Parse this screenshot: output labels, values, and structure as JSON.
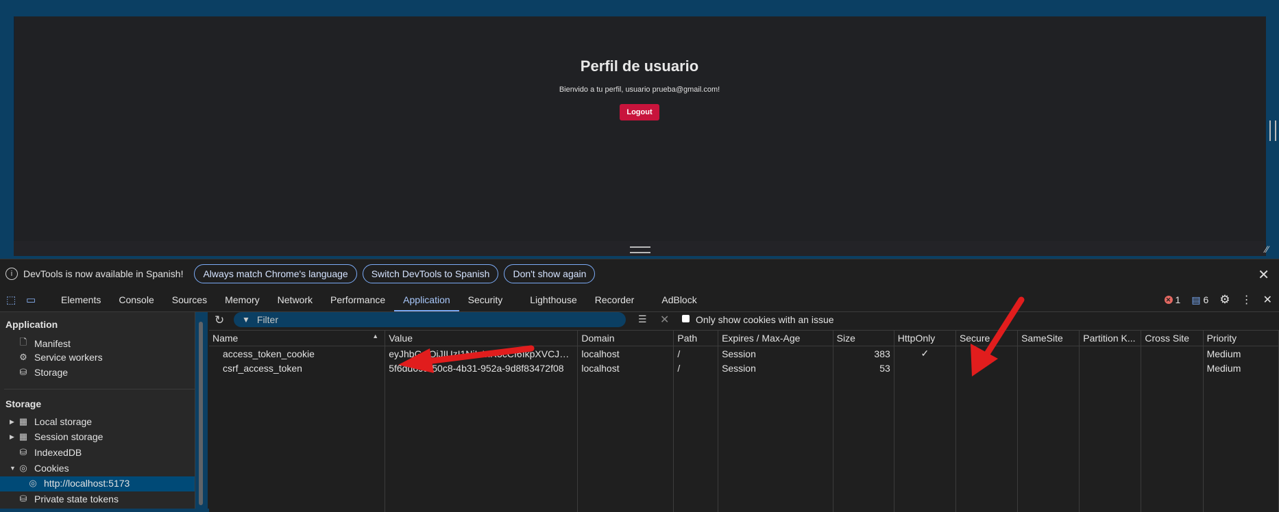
{
  "page": {
    "title": "Perfil de usuario",
    "welcome": "Bienvido a tu perfil, usuario prueba@gmail.com!",
    "logout_label": "Logout"
  },
  "infobar": {
    "message": "DevTools is now available in Spanish!",
    "btn_match": "Always match Chrome's language",
    "btn_switch": "Switch DevTools to Spanish",
    "btn_dismiss": "Don't show again"
  },
  "tabs": [
    {
      "label": "Elements"
    },
    {
      "label": "Console"
    },
    {
      "label": "Sources"
    },
    {
      "label": "Memory"
    },
    {
      "label": "Network"
    },
    {
      "label": "Performance"
    },
    {
      "label": "Application"
    },
    {
      "label": "Security"
    },
    {
      "label": "Lighthouse"
    },
    {
      "label": "Recorder"
    },
    {
      "label": "AdBlock"
    }
  ],
  "status": {
    "errors": "1",
    "messages": "6"
  },
  "sidebar": {
    "application_header": "Application",
    "app_items": [
      "Manifest",
      "Service workers",
      "Storage"
    ],
    "storage_header": "Storage",
    "storage_items": [
      "Local storage",
      "Session storage",
      "IndexedDB",
      "Cookies",
      "http://localhost:5173",
      "Private state tokens"
    ]
  },
  "filter": {
    "placeholder": "Filter",
    "only_issues_label": "Only show cookies with an issue"
  },
  "table": {
    "columns": [
      "Name",
      "Value",
      "Domain",
      "Path",
      "Expires / Max-Age",
      "Size",
      "HttpOnly",
      "Secure",
      "SameSite",
      "Partition K...",
      "Cross Site",
      "Priority"
    ],
    "rows": [
      [
        "access_token_cookie",
        "eyJhbGciOiJIUzI1NiIsInR5cCI6IkpXVCJ9.eyJmcmVz...",
        "localhost",
        "/",
        "Session",
        "383",
        "✓",
        "",
        "",
        "",
        "",
        "Medium"
      ],
      [
        "csrf_access_token",
        "5f6dd69a-50c8-4b31-952a-9d8f83472f08",
        "localhost",
        "/",
        "Session",
        "53",
        "",
        "",
        "",
        "",
        "",
        "Medium"
      ]
    ]
  },
  "colors": {
    "accent": "#7cacf8",
    "logout": "#c8143c",
    "arrow": "#e11d1d",
    "selected": "#004a77"
  }
}
